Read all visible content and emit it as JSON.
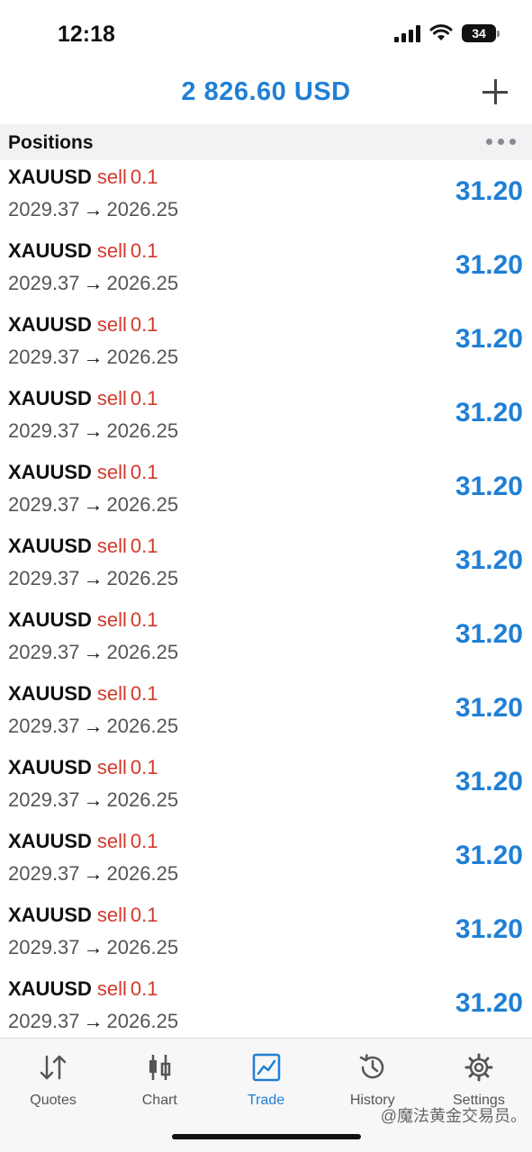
{
  "status_bar": {
    "time": "12:18",
    "battery_level": "34",
    "icons": [
      "signal-icon",
      "wifi-icon",
      "battery-icon"
    ]
  },
  "header": {
    "balance": "2 826.60 USD",
    "add_icon": "plus-icon"
  },
  "section": {
    "title": "Positions",
    "menu_icon": "more-dots-icon"
  },
  "positions": [
    {
      "symbol": "XAUUSD",
      "side": "sell",
      "volume": "0.1",
      "open_price": "2029.37",
      "arrow": "→",
      "current_price": "2026.25",
      "profit": "31.20"
    },
    {
      "symbol": "XAUUSD",
      "side": "sell",
      "volume": "0.1",
      "open_price": "2029.37",
      "arrow": "→",
      "current_price": "2026.25",
      "profit": "31.20"
    },
    {
      "symbol": "XAUUSD",
      "side": "sell",
      "volume": "0.1",
      "open_price": "2029.37",
      "arrow": "→",
      "current_price": "2026.25",
      "profit": "31.20"
    },
    {
      "symbol": "XAUUSD",
      "side": "sell",
      "volume": "0.1",
      "open_price": "2029.37",
      "arrow": "→",
      "current_price": "2026.25",
      "profit": "31.20"
    },
    {
      "symbol": "XAUUSD",
      "side": "sell",
      "volume": "0.1",
      "open_price": "2029.37",
      "arrow": "→",
      "current_price": "2026.25",
      "profit": "31.20"
    },
    {
      "symbol": "XAUUSD",
      "side": "sell",
      "volume": "0.1",
      "open_price": "2029.37",
      "arrow": "→",
      "current_price": "2026.25",
      "profit": "31.20"
    },
    {
      "symbol": "XAUUSD",
      "side": "sell",
      "volume": "0.1",
      "open_price": "2029.37",
      "arrow": "→",
      "current_price": "2026.25",
      "profit": "31.20"
    },
    {
      "symbol": "XAUUSD",
      "side": "sell",
      "volume": "0.1",
      "open_price": "2029.37",
      "arrow": "→",
      "current_price": "2026.25",
      "profit": "31.20"
    },
    {
      "symbol": "XAUUSD",
      "side": "sell",
      "volume": "0.1",
      "open_price": "2029.37",
      "arrow": "→",
      "current_price": "2026.25",
      "profit": "31.20"
    },
    {
      "symbol": "XAUUSD",
      "side": "sell",
      "volume": "0.1",
      "open_price": "2029.37",
      "arrow": "→",
      "current_price": "2026.25",
      "profit": "31.20"
    },
    {
      "symbol": "XAUUSD",
      "side": "sell",
      "volume": "0.1",
      "open_price": "2029.37",
      "arrow": "→",
      "current_price": "2026.25",
      "profit": "31.20"
    },
    {
      "symbol": "XAUUSD",
      "side": "sell",
      "volume": "0.1",
      "open_price": "2029.37",
      "arrow": "→",
      "current_price": "2026.25",
      "profit": "31.20"
    }
  ],
  "tab_bar": {
    "tabs": [
      {
        "label": "Quotes",
        "icon": "quotes-arrows-icon",
        "active": false
      },
      {
        "label": "Chart",
        "icon": "candlestick-icon",
        "active": false
      },
      {
        "label": "Trade",
        "icon": "trade-chart-icon",
        "active": true
      },
      {
        "label": "History",
        "icon": "history-clock-icon",
        "active": false
      },
      {
        "label": "Settings",
        "icon": "gear-icon",
        "active": false
      }
    ]
  },
  "watermark": "@魔法黄金交易员。",
  "colors": {
    "accent": "#1f7fd6",
    "sell": "#d23a2b",
    "text": "#111111",
    "muted": "#555555",
    "section_bg": "#f2f2f4"
  }
}
